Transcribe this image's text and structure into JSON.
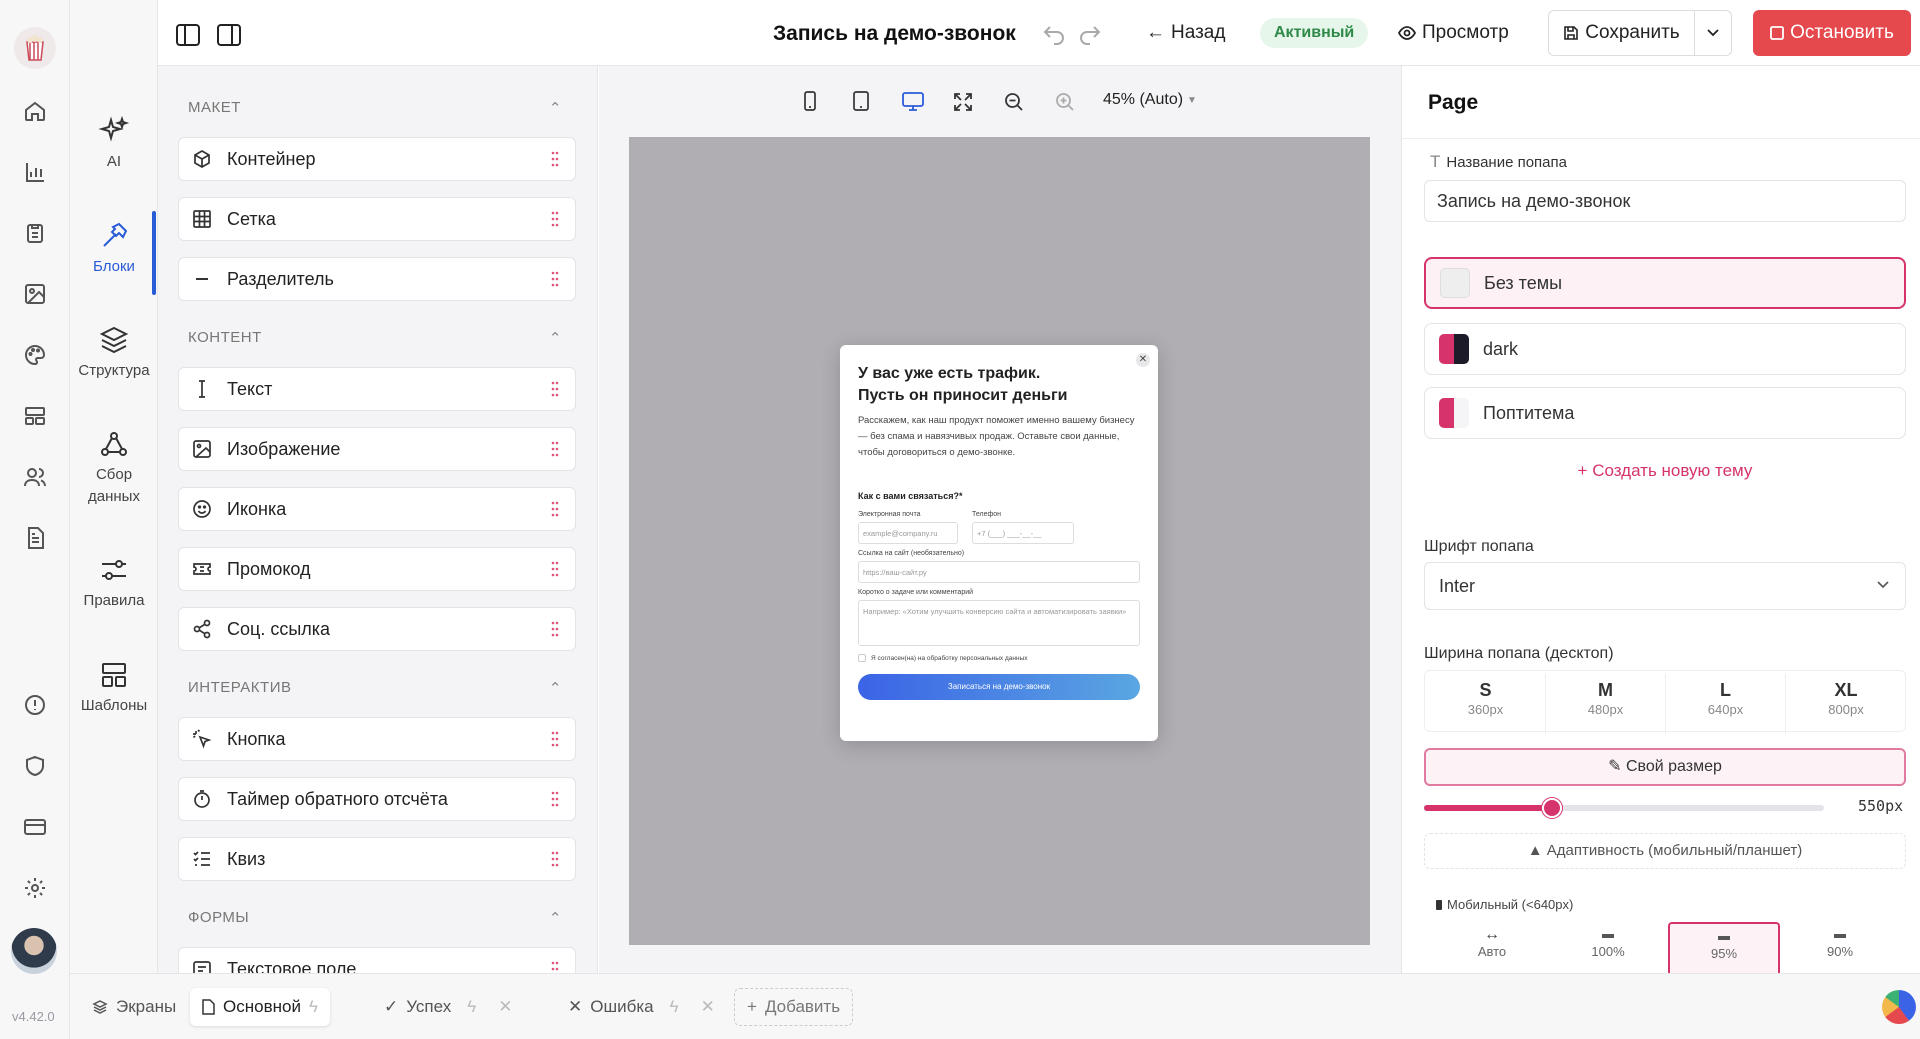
{
  "app": {
    "version": "v4.42.0"
  },
  "header": {
    "title": "Запись на демо-звонок",
    "back_label": "Назад",
    "status_badge": "Активный",
    "preview_label": "Просмотр",
    "save_label": "Сохранить",
    "stop_label": "Остановить",
    "colors": {
      "stop": "#e5484d",
      "badge_bg": "#e6f6ea",
      "badge_fg": "#2f8a4a"
    }
  },
  "rail2": {
    "items": [
      {
        "label": "AI",
        "icon": "sparkles-icon"
      },
      {
        "label": "Блоки",
        "icon": "hammer-icon",
        "active": true
      },
      {
        "label": "Структура",
        "icon": "layers-icon"
      },
      {
        "label": "Сбор данных",
        "icon": "webhook-icon"
      },
      {
        "label": "Правила",
        "icon": "sliders-icon"
      },
      {
        "label": "Шаблоны",
        "icon": "template-icon"
      }
    ]
  },
  "blocks": {
    "sections": [
      {
        "title": "МАКЕТ",
        "items": [
          {
            "label": "Контейнер",
            "icon": "box-icon"
          },
          {
            "label": "Сетка",
            "icon": "grid-icon"
          },
          {
            "label": "Разделитель",
            "icon": "minus-icon"
          }
        ]
      },
      {
        "title": "КОНТЕНТ",
        "items": [
          {
            "label": "Текст",
            "icon": "text-cursor-icon"
          },
          {
            "label": "Изображение",
            "icon": "image-icon"
          },
          {
            "label": "Иконка",
            "icon": "smile-icon"
          },
          {
            "label": "Промокод",
            "icon": "ticket-icon"
          },
          {
            "label": "Соц. ссылка",
            "icon": "share-icon"
          }
        ]
      },
      {
        "title": "ИНТЕРАКТИВ",
        "items": [
          {
            "label": "Кнопка",
            "icon": "pointer-click-icon"
          },
          {
            "label": "Таймер обратного отсчёта",
            "icon": "timer-icon"
          },
          {
            "label": "Квиз",
            "icon": "list-checks-icon"
          }
        ]
      },
      {
        "title": "ФОРМЫ",
        "items": [
          {
            "label": "Текстовое поле",
            "icon": "form-input-icon"
          }
        ]
      }
    ]
  },
  "canvas": {
    "zoom": "45% (Auto)",
    "popup": {
      "title_line1": "У вас уже есть трафик.",
      "title_line2": "Пусть он приносит деньги",
      "description": "Расскажем, как наш продукт поможет именно вашему бизнесу — без спама и навязчивых продаж. Оставьте свои данные, чтобы договориться о демо-звонке.",
      "question": "Как с вами связаться?*",
      "email_label": "Электронная почта",
      "email_placeholder": "example@company.ru",
      "phone_label": "Телефон",
      "phone_placeholder": "+7 (___) ___-__-__",
      "site_label": "Ссылка на сайт (необязательно)",
      "site_placeholder": "https://ваш-сайт.ру",
      "comment_label": "Коротко о задаче или комментарий",
      "comment_placeholder": "Например: «Хотим улучшить конверсию сайта и автоматизировать заявки»",
      "consent": "Я согласен(на) на обработку персональных данных",
      "submit": "Записаться на демо-звонок"
    }
  },
  "props": {
    "panel_title": "Page",
    "name_label": "Название попапа",
    "name_value": "Запись на демо-звонок",
    "themes": [
      {
        "name": "Без темы",
        "color": "#eeeeee",
        "selected": true
      },
      {
        "name": "dark",
        "color": "#d6336c"
      },
      {
        "name": "Поптитема",
        "color": "#d6336c"
      }
    ],
    "create_theme": "+ Создать новую тему",
    "font_label": "Шрифт попапа",
    "font_value": "Inter",
    "width_label": "Ширина попапа (десктоп)",
    "sizes": [
      {
        "name": "S",
        "px": "360px"
      },
      {
        "name": "M",
        "px": "480px"
      },
      {
        "name": "L",
        "px": "640px"
      },
      {
        "name": "XL",
        "px": "800px"
      }
    ],
    "custom_size": "✎ Свой размер",
    "slider_value": "550px",
    "slider_fraction": 0.32,
    "adaptive": "▲ Адаптивность (мобильный/планшет)",
    "mobile_label": "Мобильный (<640px)",
    "mobile_options": [
      "Авто",
      "100%",
      "95%",
      "90%"
    ],
    "accent": "#d6336c"
  },
  "bottom": {
    "screens_label": "Экраны",
    "tabs": [
      {
        "label": "Основной",
        "active": true
      },
      {
        "label": "Успех"
      },
      {
        "label": "Ошибка"
      }
    ],
    "add_label": "Добавить"
  }
}
